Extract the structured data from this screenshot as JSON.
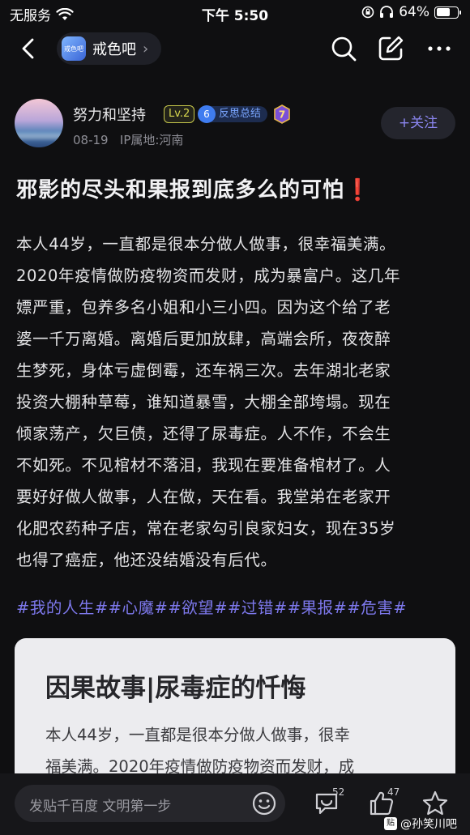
{
  "status_bar": {
    "carrier": "无服务",
    "time": "下午 5:50",
    "battery_percent": "64%",
    "battery_level": 0.64
  },
  "nav": {
    "forum_logo_text": "戒色吧",
    "forum_name": "戒色吧",
    "chevron": "›",
    "icons": [
      "back-icon",
      "search-icon",
      "edit-icon",
      "more-icon"
    ]
  },
  "author": {
    "name": "努力和坚持",
    "level": "Lv.2",
    "title_level": "6",
    "title": "反思总结",
    "medal": "7",
    "date": "08-19",
    "ip_label": "IP属地:河南",
    "follow_label": "+关注"
  },
  "post": {
    "title": "邪影的尽头和果报到底多么的可怕",
    "title_mark": "❗",
    "body_lines": [
      "本人44岁，一直都是很本分做人做事，很幸福美满。",
      "2020年疫情做防疫物资而发财，成为暴富户。这几年",
      "嫖严重，包养多名小姐和小三小四。因为这个给了老",
      "婆一千万离婚。离婚后更加放肆，高端会所，夜夜醉",
      "生梦死，身体亏虚倒霉，还车祸三次。去年湖北老家",
      "投资大棚种草莓，谁知道暴雪，大棚全部垮塌。现在",
      "倾家荡产，欠巨债，还得了尿毒症。人不作，不会生",
      "不如死。不见棺材不落泪，我现在要准备棺材了。人",
      "要好好做人做事，人在做，天在看。我堂弟在老家开",
      "化肥农药种子店，常在老家勾引良家妇女，现在35岁",
      "也得了癌症，他还没结婚没有后代。"
    ],
    "tags": "#我的人生##心魔##欲望##过错##果报##危害#"
  },
  "card": {
    "title": "因果故事|尿毒症的忏悔",
    "text_lines": [
      "本人44岁，一直都是很本分做人做事，很幸",
      "福美满。2020年疫情做防疫物资而发财，成"
    ]
  },
  "bottom_bar": {
    "comment_placeholder": "发贴千百度 文明第一步",
    "comment_count": "52",
    "like_count": "47",
    "watermark_logo": "贴",
    "watermark": "@孙笑川吧"
  },
  "colors": {
    "background": "#0f0f11",
    "accent": "#7d78ec",
    "level_badge": "#d8d84e",
    "title_badge": "#3f7cf0"
  }
}
